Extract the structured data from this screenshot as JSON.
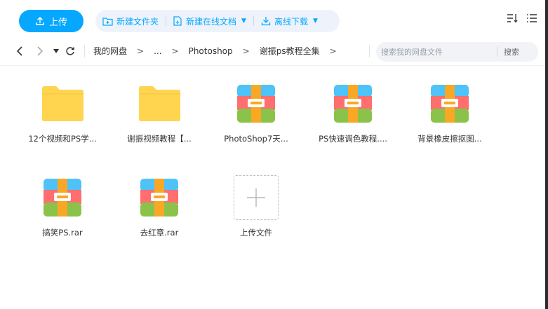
{
  "toolbar": {
    "upload_label": "上传",
    "actions": [
      {
        "label": "新建文件夹",
        "has_dropdown": false
      },
      {
        "label": "新建在线文档",
        "has_dropdown": true
      },
      {
        "label": "离线下载",
        "has_dropdown": true
      }
    ],
    "dropdown_glyph": "▼"
  },
  "nav": {
    "crumbs": [
      "我的网盘",
      "...",
      "Photoshop",
      "谢振ps教程全集"
    ],
    "separator": ">",
    "search_placeholder": "搜索我的网盘文件",
    "search_button": "搜索"
  },
  "files": [
    {
      "name": "12个视频和PS学...",
      "kind": "folder"
    },
    {
      "name": "谢振视频教程【...",
      "kind": "folder"
    },
    {
      "name": "PhotoShop7天...",
      "kind": "archive"
    },
    {
      "name": "PS快速调色教程....",
      "kind": "archive"
    },
    {
      "name": "背景橡皮擦抠图...",
      "kind": "archive"
    },
    {
      "name": "搞笑PS.rar",
      "kind": "archive"
    },
    {
      "name": "去红章.rar",
      "kind": "archive"
    },
    {
      "name": "上传文件",
      "kind": "upload"
    }
  ],
  "colors": {
    "accent": "#06a7ff",
    "folder": "#ffd54f",
    "archive_top": "#4fc3f7",
    "archive_mid": "#ff6f6f",
    "archive_bottom": "#8bc34a",
    "archive_strap": "#f9a825"
  }
}
